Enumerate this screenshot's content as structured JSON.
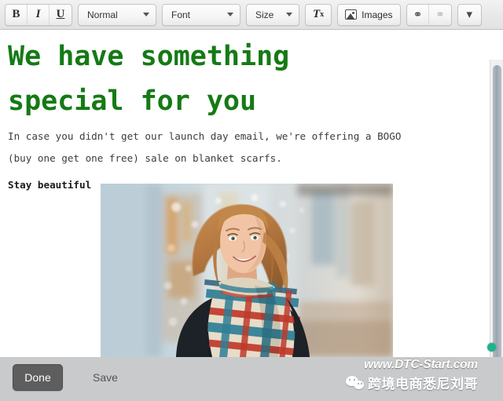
{
  "toolbar": {
    "bold_label": "B",
    "italic_label": "I",
    "underline_label": "U",
    "style_select": "Normal",
    "font_select": "Font",
    "size_select": "Size",
    "clear_format_label": "T",
    "clear_format_sub": "x",
    "images_label": "Images",
    "link_icon": "⚭",
    "unlink_icon": "⚭",
    "more_icon": "⌄"
  },
  "document": {
    "headline_line1": "We have something",
    "headline_line2": "special for you",
    "headline_color": "#157a15",
    "body_line1": "In case you didn't get our launch day email, we're offering a BOGO",
    "body_line2": "(buy one get one free) sale on blanket scarfs.",
    "signoff": "Stay beautiful",
    "image_alt": "woman-in-plaid-blanket-scarf-photo"
  },
  "footer": {
    "done_label": "Done",
    "save_label": "Save"
  },
  "watermark": {
    "url": "www.DTC-Start.com",
    "chinese": "跨境电商悉尼刘哥"
  }
}
